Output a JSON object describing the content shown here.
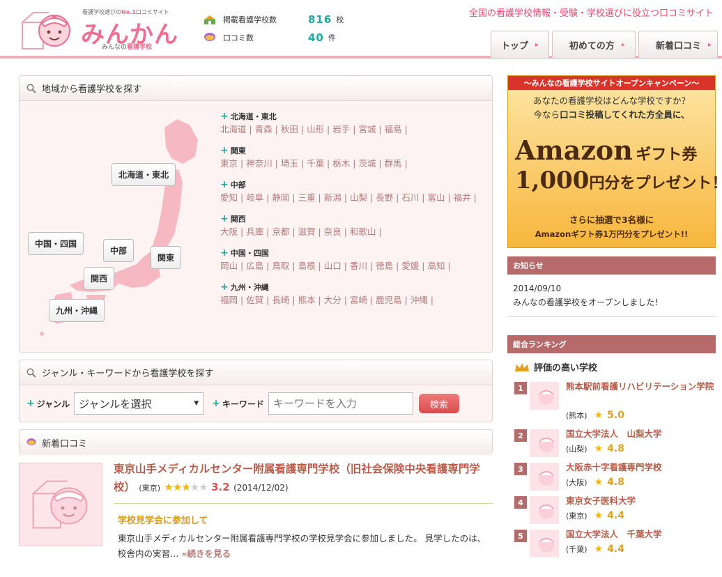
{
  "header": {
    "logo_tagline_pre": "看護学校選びの",
    "logo_tagline_no1": "No.1",
    "logo_tagline_post": "口コミサイト",
    "logo_main": "みんかん",
    "logo_sub_pre": "みんなの",
    "logo_sub_em": "看護学校",
    "stats": [
      {
        "label": "掲載看護学校数",
        "value": "816",
        "unit": "校",
        "icon": "school-icon"
      },
      {
        "label": "口コミ数",
        "value": "40",
        "unit": "件",
        "icon": "speech-bubble-icon"
      }
    ],
    "tagline": "全国の看護学校情報・受験・学校選びに役立つ口コミサイト",
    "nav": [
      {
        "label": "トップ",
        "arrow": "▸"
      },
      {
        "label": "初めての方",
        "arrow": "▸"
      },
      {
        "label": "新着口コミ",
        "arrow": "▸"
      }
    ]
  },
  "region_search": {
    "title": "地域から看護学校を探す",
    "map_buttons": [
      "北海道・東北",
      "中国・四国",
      "中部",
      "関東",
      "関西",
      "九州・沖縄"
    ],
    "regions": [
      {
        "name": "北海道・東北",
        "prefs": [
          "北海道",
          "青森",
          "秋田",
          "山形",
          "岩手",
          "宮城",
          "福島"
        ]
      },
      {
        "name": "関東",
        "prefs": [
          "東京",
          "神奈川",
          "埼玉",
          "千葉",
          "栃木",
          "茨城",
          "群馬"
        ]
      },
      {
        "name": "中部",
        "prefs": [
          "愛知",
          "岐阜",
          "静岡",
          "三重",
          "新潟",
          "山梨",
          "長野",
          "石川",
          "富山",
          "福井"
        ]
      },
      {
        "name": "関西",
        "prefs": [
          "大阪",
          "兵庫",
          "京都",
          "滋賀",
          "奈良",
          "和歌山"
        ]
      },
      {
        "name": "中国・四国",
        "prefs": [
          "岡山",
          "広島",
          "鳥取",
          "島根",
          "山口",
          "香川",
          "徳島",
          "愛媛",
          "高知"
        ]
      },
      {
        "name": "九州・沖縄",
        "prefs": [
          "福岡",
          "佐賀",
          "長崎",
          "熊本",
          "大分",
          "宮崎",
          "鹿児島",
          "沖縄"
        ]
      }
    ]
  },
  "keyword_search": {
    "title": "ジャンル・キーワードから看護学校を探す",
    "genre_label": "ジャンル",
    "genre_selected": "ジャンルを選択",
    "keyword_label": "キーワード",
    "keyword_placeholder": "キーワードを入力",
    "button": "検索"
  },
  "new_reviews": {
    "title": "新着口コミ",
    "item": {
      "school": "東京山手メディカルセンター附属看護専門学校（旧社会保険中央看護専門学校）",
      "pref": "(東京)",
      "rating": 3.2,
      "rating_text": "3.2",
      "date": "(2014/12/02)",
      "headline": "学校見学会に参加して",
      "body": "東京山手メディカルセンター附属看護専門学校の学校見学会に参加しました。 見学したのは、校舎内の実習…",
      "more": "»続きを見る"
    }
  },
  "campaign": {
    "top": "～みんなの看護学校サイトオープンキャンペーン～",
    "line1": "あなたの看護学校はどんな学校ですか？",
    "line2_pre": "今なら",
    "line2_em": "口コミ投稿してくれた方全員に、",
    "amazon": "Amazon",
    "gift": "ギフト券",
    "yen_amount": "1,000",
    "yen_rest": "円分をプレゼント！",
    "bottom1": "さらに抽選で3名様に",
    "bottom2": "Amazonギフト券1万円分をプレゼント!!"
  },
  "news": {
    "title": "お知らせ",
    "date": "2014/09/10",
    "text": "みんなの看護学校をオープンしました！"
  },
  "ranking": {
    "title": "総合ランキング",
    "subtitle": "評価の高い学校",
    "items": [
      {
        "rank": "1",
        "name": "熊本駅前看護リハビリテーション学院",
        "pref": "(熊本)",
        "score": "5.0"
      },
      {
        "rank": "2",
        "name": "国立大学法人　山梨大学",
        "pref": "(山梨)",
        "score": "4.8"
      },
      {
        "rank": "3",
        "name": "大阪赤十字看護専門学校",
        "pref": "(大阪)",
        "score": "4.8"
      },
      {
        "rank": "4",
        "name": "東京女子医科大学",
        "pref": "(東京)",
        "score": "4.4"
      },
      {
        "rank": "5",
        "name": "国立大学法人　千葉大学",
        "pref": "(千葉)",
        "score": "4.4"
      }
    ]
  },
  "colors": {
    "brand_pink": "#ee6f93",
    "teal": "#1ea99d",
    "panel_bg": "#fdf3f3",
    "rank_header": "#b76a6a"
  }
}
